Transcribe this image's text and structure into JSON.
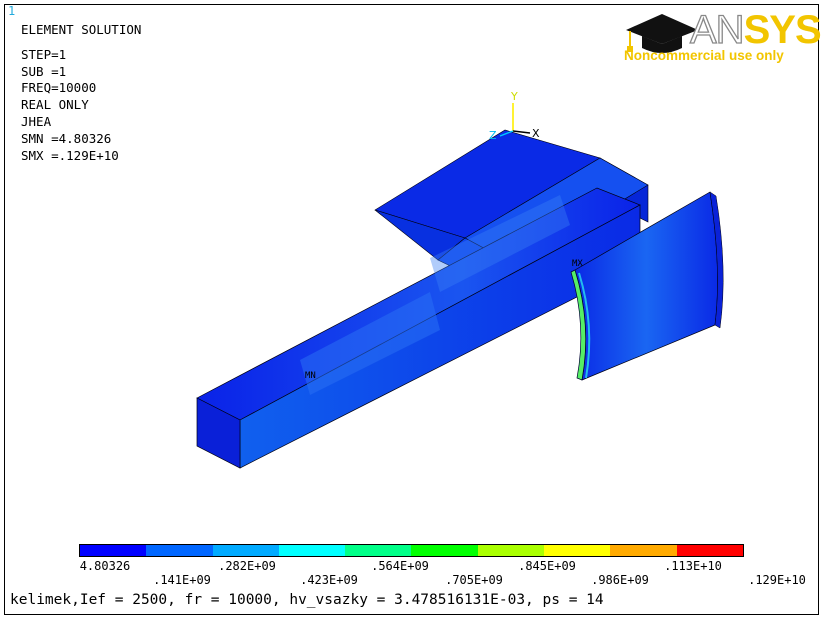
{
  "window_number": "1",
  "header": {
    "title": "ELEMENT SOLUTION",
    "lines": [
      "STEP=1",
      "SUB =1",
      "FREQ=10000",
      "REAL ONLY",
      "JHEA",
      "SMN =4.80326",
      "SMX =.129E+10"
    ]
  },
  "logo": {
    "text_an": "AN",
    "text_sys": "SYS",
    "tagline": "Noncommercial use only",
    "icon": "mortarboard-icon",
    "color": "#f2c500"
  },
  "triad": {
    "x": "X",
    "y": "Y",
    "z": "Z"
  },
  "markers": {
    "min": "MN",
    "max": "MX"
  },
  "legend": {
    "colors": [
      "#0000ff",
      "#0066ff",
      "#00aaff",
      "#00ffff",
      "#00ff88",
      "#00ff00",
      "#aaff00",
      "#ffff00",
      "#ffaa00",
      "#ff0000"
    ],
    "top_labels": [
      "4.80326",
      ".282E+09",
      ".564E+09",
      ".845E+09",
      ".113E+10"
    ],
    "bottom_labels": [
      ".141E+09",
      ".423E+09",
      ".705E+09",
      ".986E+09",
      ".129E+10"
    ]
  },
  "footer": "kelimek,Ief = 2500, fr = 10000, hv_vsazky = 3.478516131E-03, ps = 14"
}
